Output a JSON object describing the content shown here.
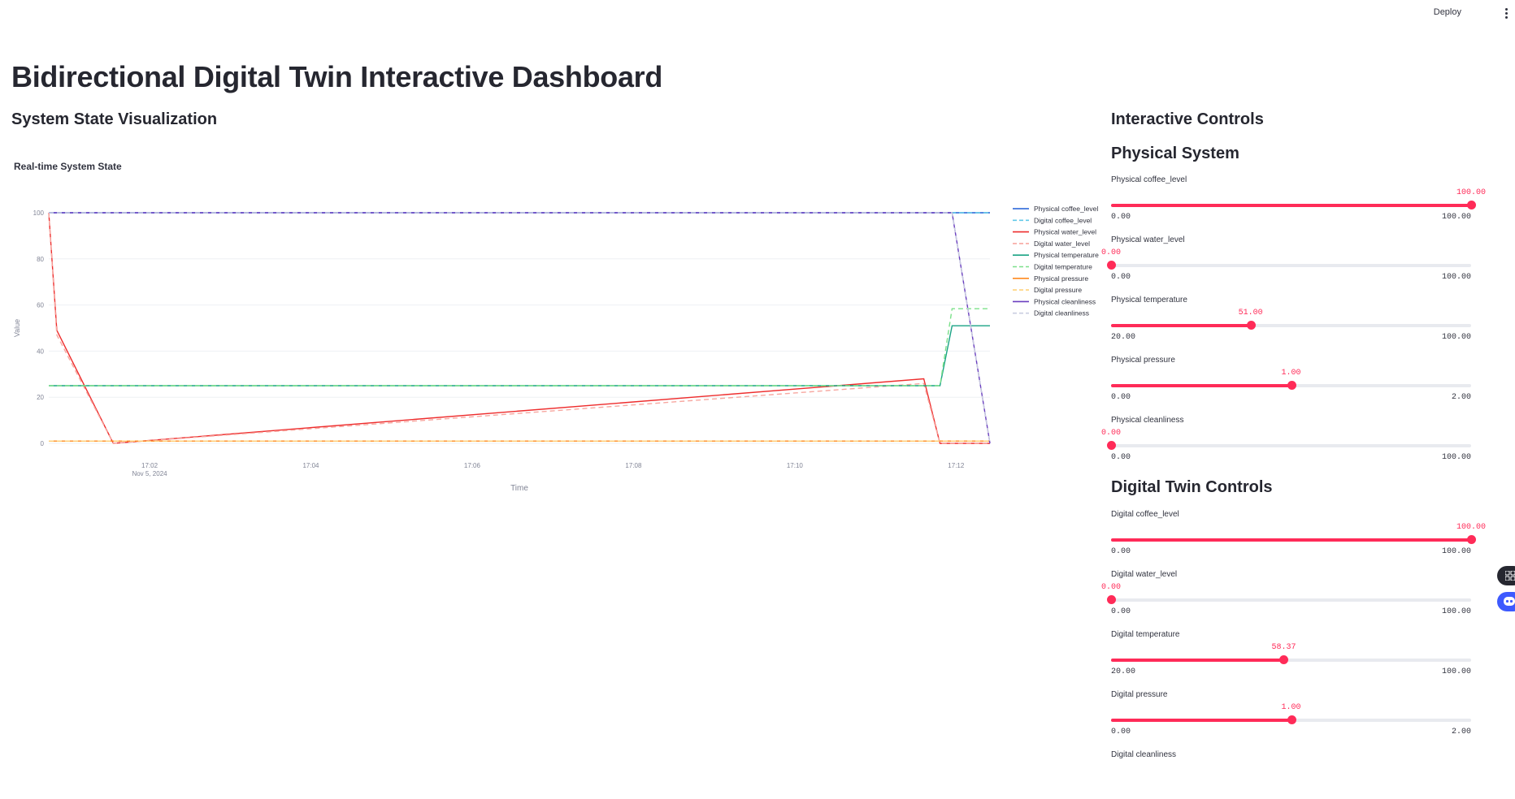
{
  "header": {
    "deploy_label": "Deploy",
    "menu_icon": "kebab-menu-icon"
  },
  "page": {
    "title": "Bidirectional Digital Twin Interactive Dashboard"
  },
  "left": {
    "heading": "System State Visualization"
  },
  "right": {
    "heading": "Interactive Controls",
    "physical_heading": "Physical System",
    "digital_heading": "Digital Twin Controls"
  },
  "physical_sliders": [
    {
      "label": "Physical coffee_level",
      "value": "100.00",
      "min": "0.00",
      "max": "100.00",
      "fraction": 1.0
    },
    {
      "label": "Physical water_level",
      "value": "0.00",
      "min": "0.00",
      "max": "100.00",
      "fraction": 0.0
    },
    {
      "label": "Physical temperature",
      "value": "51.00",
      "min": "20.00",
      "max": "100.00",
      "fraction": 0.3875
    },
    {
      "label": "Physical pressure",
      "value": "1.00",
      "min": "0.00",
      "max": "2.00",
      "fraction": 0.5
    },
    {
      "label": "Physical cleanliness",
      "value": "0.00",
      "min": "0.00",
      "max": "100.00",
      "fraction": 0.0
    }
  ],
  "digital_sliders": [
    {
      "label": "Digital coffee_level",
      "value": "100.00",
      "min": "0.00",
      "max": "100.00",
      "fraction": 1.0
    },
    {
      "label": "Digital water_level",
      "value": "0.00",
      "min": "0.00",
      "max": "100.00",
      "fraction": 0.0
    },
    {
      "label": "Digital temperature",
      "value": "58.37",
      "min": "20.00",
      "max": "100.00",
      "fraction": 0.4796
    },
    {
      "label": "Digital pressure",
      "value": "1.00",
      "min": "0.00",
      "max": "2.00",
      "fraction": 0.5
    },
    {
      "label": "Digital cleanliness"
    }
  ],
  "chart_data": {
    "type": "line",
    "title": "Real-time System State",
    "xlabel": "Time",
    "ylabel": "Value",
    "ylim": [
      0,
      100
    ],
    "yticks": [
      0,
      20,
      40,
      60,
      80,
      100
    ],
    "x_range_minutes": [
      "17:00:45",
      "17:12:25"
    ],
    "xticks": [
      {
        "t": 2,
        "label": "17:02",
        "sublabel": "Nov 5, 2024"
      },
      {
        "t": 4,
        "label": "17:04"
      },
      {
        "t": 6,
        "label": "17:06"
      },
      {
        "t": 8,
        "label": "17:08"
      },
      {
        "t": 10,
        "label": "17:10"
      },
      {
        "t": 12,
        "label": "17:12"
      }
    ],
    "grid": true,
    "legend_position": "right",
    "series": [
      {
        "name": "Physical coffee_level",
        "color": "#1f5fd6",
        "dash": false,
        "points": [
          [
            0.75,
            100
          ],
          [
            12.42,
            100
          ]
        ]
      },
      {
        "name": "Digital coffee_level",
        "color": "#61c8e8",
        "dash": true,
        "points": [
          [
            0.75,
            100
          ],
          [
            12.42,
            100
          ]
        ]
      },
      {
        "name": "Physical water_level",
        "color": "#ee2d2d",
        "dash": false,
        "points": [
          [
            0.75,
            100
          ],
          [
            0.85,
            49
          ],
          [
            1.55,
            0
          ],
          [
            11.6,
            28
          ],
          [
            11.8,
            0
          ],
          [
            12.42,
            0
          ]
        ]
      },
      {
        "name": "Digital water_level",
        "color": "#f7a7a0",
        "dash": true,
        "points": [
          [
            0.75,
            100
          ],
          [
            0.85,
            47
          ],
          [
            1.55,
            0
          ],
          [
            11.6,
            26
          ],
          [
            11.8,
            0
          ],
          [
            12.42,
            0
          ]
        ]
      },
      {
        "name": "Physical temperature",
        "color": "#1aa384",
        "dash": false,
        "points": [
          [
            0.75,
            25
          ],
          [
            11.8,
            25
          ],
          [
            11.95,
            51
          ],
          [
            12.42,
            51
          ]
        ]
      },
      {
        "name": "Digital temperature",
        "color": "#7be08a",
        "dash": true,
        "points": [
          [
            0.75,
            25
          ],
          [
            11.8,
            25
          ],
          [
            11.95,
            58.37
          ],
          [
            12.42,
            58.37
          ]
        ]
      },
      {
        "name": "Physical pressure",
        "color": "#ff8a1f",
        "dash": false,
        "points": [
          [
            0.75,
            1
          ],
          [
            12.42,
            1
          ]
        ]
      },
      {
        "name": "Digital pressure",
        "color": "#ffd27a",
        "dash": true,
        "points": [
          [
            0.75,
            1
          ],
          [
            12.42,
            1
          ]
        ]
      },
      {
        "name": "Physical cleanliness",
        "color": "#6a3fbf",
        "dash": false,
        "points": [
          [
            0.75,
            100
          ],
          [
            11.95,
            100
          ],
          [
            12.42,
            0
          ]
        ]
      },
      {
        "name": "Digital cleanliness",
        "color": "#c9cde0",
        "dash": true,
        "points": [
          [
            0.75,
            100
          ],
          [
            11.95,
            100
          ],
          [
            12.42,
            0
          ]
        ]
      }
    ]
  }
}
